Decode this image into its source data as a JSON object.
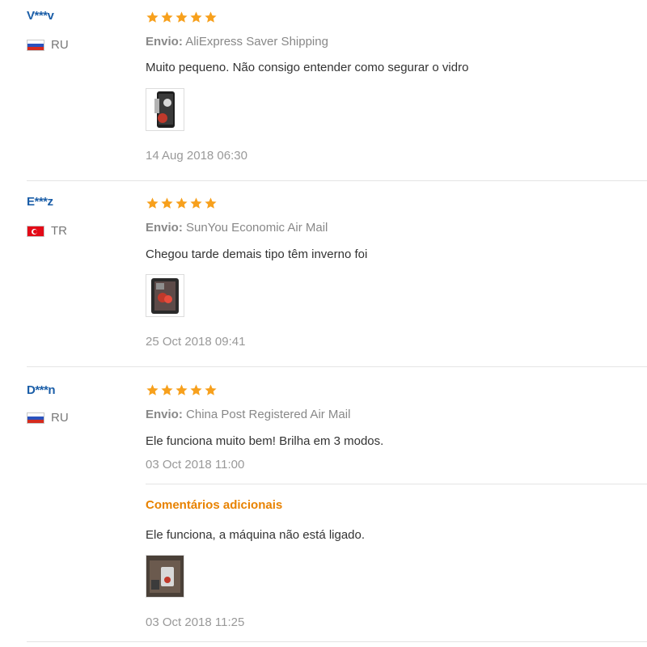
{
  "shipping_label": "Envio:",
  "reviews": [
    {
      "user": "V***v",
      "country": "RU",
      "rating": 5,
      "shipping": "AliExpress Saver Shipping",
      "text": "Muito pequeno. Não consigo entender como segurar o vidro",
      "date": "14 Aug 2018 06:30"
    },
    {
      "user": "E***z",
      "country": "TR",
      "rating": 5,
      "shipping": "SunYou Economic Air Mail",
      "text": "Chegou tarde demais tipo têm inverno foi",
      "date": "25 Oct 2018 09:41"
    },
    {
      "user": "D***n",
      "country": "RU",
      "rating": 5,
      "shipping": "China Post Registered Air Mail",
      "text": "Ele funciona muito bem! Brilha em 3 modos.",
      "date": "03 Oct 2018 11:00",
      "additional": {
        "heading": "Comentários adicionais",
        "text": "Ele funciona, a máquina não está ligado.",
        "date": "03 Oct 2018 11:25"
      }
    }
  ],
  "colors": {
    "star": "#f7a01c",
    "username": "#1b5ea8",
    "additional_heading": "#e88200"
  }
}
